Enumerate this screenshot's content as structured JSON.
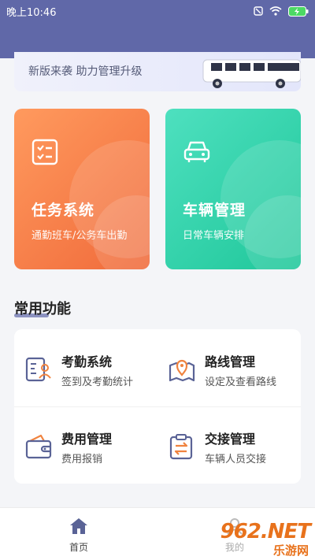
{
  "status_bar": {
    "time": "晚上10:46",
    "battery": "100"
  },
  "banner": {
    "text": "新版来袭 助力管理升级"
  },
  "cards": [
    {
      "title": "任务系统",
      "subtitle": "通勤班车/公务车出勤",
      "icon": "task-list-icon"
    },
    {
      "title": "车辆管理",
      "subtitle": "日常车辆安排",
      "icon": "car-icon"
    }
  ],
  "section": {
    "title": "常用功能"
  },
  "functions": [
    {
      "title": "考勤系统",
      "subtitle": "签到及考勤统计",
      "icon": "attendance-icon"
    },
    {
      "title": "路线管理",
      "subtitle": "设定及查看路线",
      "icon": "map-pin-icon"
    },
    {
      "title": "费用管理",
      "subtitle": "费用报销",
      "icon": "wallet-icon"
    },
    {
      "title": "交接管理",
      "subtitle": "车辆人员交接",
      "icon": "clipboard-exchange-icon"
    }
  ],
  "tabs": [
    {
      "label": "首页",
      "icon": "home-icon",
      "active": true
    },
    {
      "label": "我的",
      "icon": "user-icon",
      "active": false
    }
  ],
  "watermark": {
    "logo": "962.NET",
    "sub": "乐游网"
  },
  "colors": {
    "primary": "#6068a8",
    "task_card": "#f47a45",
    "vehicle_card": "#2fd3a8",
    "watermark": "#e8721c"
  }
}
